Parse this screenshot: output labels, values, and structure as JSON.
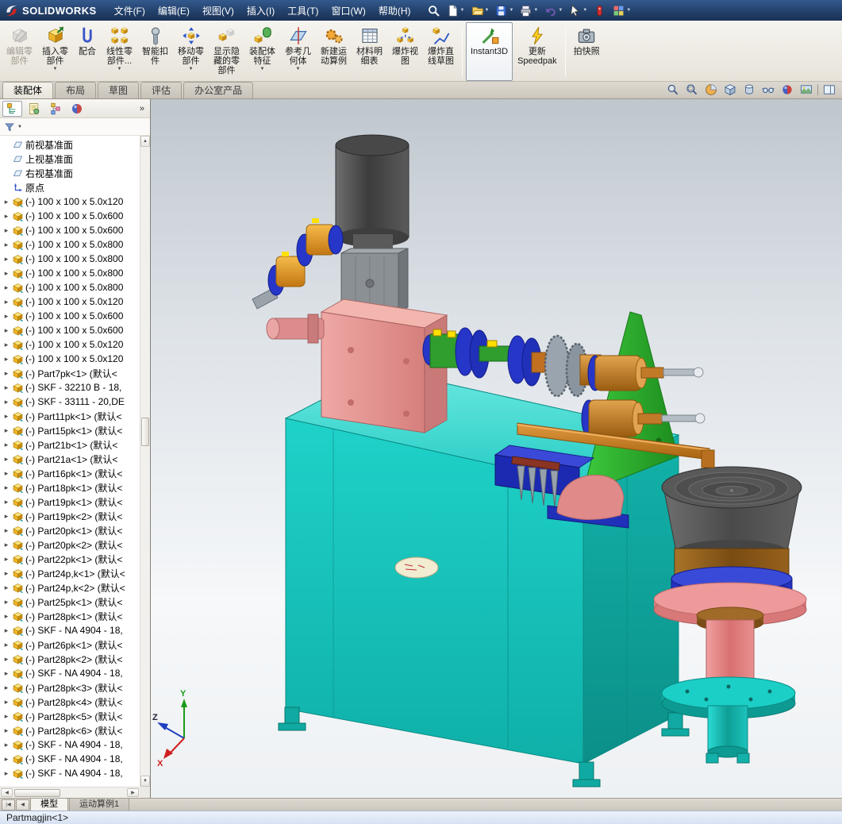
{
  "window": {
    "logo_text": "SOLIDWORKS",
    "status_bar_text": "Partmagjin<1>"
  },
  "menu_bar": {
    "items": [
      "文件(F)",
      "编辑(E)",
      "视图(V)",
      "插入(I)",
      "工具(T)",
      "窗口(W)",
      "帮助(H)"
    ]
  },
  "quick_toolbar": {
    "buttons": [
      {
        "name": "search",
        "dropdown": false
      },
      {
        "name": "new-document",
        "dropdown": true
      },
      {
        "name": "open",
        "dropdown": true
      },
      {
        "name": "save",
        "dropdown": true
      },
      {
        "name": "print",
        "dropdown": true
      },
      {
        "name": "undo",
        "dropdown": true
      },
      {
        "name": "select",
        "dropdown": true
      },
      {
        "name": "rebuild",
        "dropdown": false
      },
      {
        "name": "display-pane",
        "dropdown": true
      }
    ]
  },
  "ribbon": {
    "buttons": [
      {
        "id": "edit-component",
        "label": "编辑零\n部件",
        "dropdown": false,
        "disabled": true
      },
      {
        "id": "insert-component",
        "label": "插入零\n部件",
        "dropdown": true
      },
      {
        "id": "mate",
        "label": "配合",
        "dropdown": false
      },
      {
        "id": "linear-component-pattern",
        "label": "线性零\n部件...",
        "dropdown": true
      },
      {
        "id": "smart-fasteners",
        "label": "智能扣\n件",
        "dropdown": false
      },
      {
        "id": "move-component",
        "label": "移动零\n部件",
        "dropdown": true
      },
      {
        "id": "show-hidden-components",
        "label": "显示隐\n藏的零\n部件",
        "dropdown": false
      },
      {
        "id": "assembly-features",
        "label": "装配体\n特征",
        "dropdown": true
      },
      {
        "id": "reference-geometry",
        "label": "参考几\n何体",
        "dropdown": true
      },
      {
        "id": "new-motion-study",
        "label": "新建运\n动算例",
        "dropdown": false
      },
      {
        "id": "bill-of-materials",
        "label": "材料明\n细表",
        "dropdown": false
      },
      {
        "id": "exploded-view",
        "label": "爆炸视\n图",
        "dropdown": false
      },
      {
        "id": "explode-line-sketch",
        "label": "爆炸直\n线草图",
        "dropdown": false
      },
      {
        "id": "instant3d",
        "label": "Instant3D",
        "dropdown": false,
        "active": true,
        "sep_before": true
      },
      {
        "id": "update-speedpak",
        "label": "更新\nSpeedpak",
        "dropdown": false
      },
      {
        "id": "take-snapshot",
        "label": "拍快照",
        "dropdown": false,
        "sep_before": true
      }
    ]
  },
  "tab_bar": {
    "tabs": [
      {
        "id": "assembly",
        "label": "装配体",
        "active": true
      },
      {
        "id": "layout",
        "label": "布局",
        "active": false
      },
      {
        "id": "sketch",
        "label": "草图",
        "active": false
      },
      {
        "id": "evaluate",
        "label": "评估",
        "active": false
      },
      {
        "id": "office-products",
        "label": "办公室产品",
        "active": false
      }
    ]
  },
  "feature_tree": {
    "panel_tabs": [
      "featuremanager",
      "propertymanager",
      "configurationmanager",
      "displaymanager"
    ],
    "chevrons": "»",
    "items": [
      {
        "icon": "plane",
        "expand": false,
        "label": "前视基准面"
      },
      {
        "icon": "plane",
        "expand": false,
        "label": "上视基准面"
      },
      {
        "icon": "plane",
        "expand": false,
        "label": "右视基准面"
      },
      {
        "icon": "origin",
        "expand": false,
        "label": "原点"
      },
      {
        "icon": "part",
        "expand": true,
        "label": "(-) 100 x 100 x 5.0x120"
      },
      {
        "icon": "part",
        "expand": true,
        "label": "(-) 100 x 100 x 5.0x600"
      },
      {
        "icon": "part",
        "expand": true,
        "label": "(-) 100 x 100 x 5.0x600"
      },
      {
        "icon": "part",
        "expand": true,
        "label": "(-) 100 x 100 x 5.0x800"
      },
      {
        "icon": "part",
        "expand": true,
        "label": "(-) 100 x 100 x 5.0x800"
      },
      {
        "icon": "part",
        "expand": true,
        "label": "(-) 100 x 100 x 5.0x800"
      },
      {
        "icon": "part",
        "expand": true,
        "label": "(-) 100 x 100 x 5.0x800"
      },
      {
        "icon": "part",
        "expand": true,
        "label": "(-) 100 x 100 x 5.0x120"
      },
      {
        "icon": "part",
        "expand": true,
        "label": "(-) 100 x 100 x 5.0x600"
      },
      {
        "icon": "part",
        "expand": true,
        "label": "(-) 100 x 100 x 5.0x600"
      },
      {
        "icon": "part",
        "expand": true,
        "label": "(-) 100 x 100 x 5.0x120"
      },
      {
        "icon": "part",
        "expand": true,
        "label": "(-) 100 x 100 x 5.0x120"
      },
      {
        "icon": "part",
        "expand": true,
        "label": "(-) Part7pk<1> (默认<"
      },
      {
        "icon": "part",
        "expand": true,
        "label": "(-) SKF - 32210 B - 18,"
      },
      {
        "icon": "part",
        "expand": true,
        "label": "(-) SKF - 33111 - 20,DE"
      },
      {
        "icon": "part",
        "expand": true,
        "label": "(-) Part11pk<1> (默认<"
      },
      {
        "icon": "part",
        "expand": true,
        "label": "(-) Part15pk<1> (默认<"
      },
      {
        "icon": "part",
        "expand": true,
        "label": "(-) Part21b<1> (默认<"
      },
      {
        "icon": "part",
        "expand": true,
        "label": "(-) Part21a<1> (默认<"
      },
      {
        "icon": "part",
        "expand": true,
        "label": "(-) Part16pk<1> (默认<"
      },
      {
        "icon": "part",
        "expand": true,
        "label": "(-) Part18pk<1> (默认<"
      },
      {
        "icon": "part",
        "expand": true,
        "label": "(-) Part19pk<1> (默认<"
      },
      {
        "icon": "part",
        "expand": true,
        "label": "(-) Part19pk<2> (默认<"
      },
      {
        "icon": "part",
        "expand": true,
        "label": "(-) Part20pk<1> (默认<"
      },
      {
        "icon": "part",
        "expand": true,
        "label": "(-) Part20pk<2> (默认<"
      },
      {
        "icon": "part",
        "expand": true,
        "label": "(-) Part22pk<1> (默认<"
      },
      {
        "icon": "part",
        "expand": true,
        "label": "(-) Part24p,k<1> (默认<"
      },
      {
        "icon": "part",
        "expand": true,
        "label": "(-) Part24p,k<2> (默认<"
      },
      {
        "icon": "part",
        "expand": true,
        "label": "(-) Part25pk<1> (默认<"
      },
      {
        "icon": "part",
        "expand": true,
        "label": "(-) Part28pk<1> (默认<"
      },
      {
        "icon": "part",
        "expand": true,
        "label": "(-) SKF - NA 4904 - 18,"
      },
      {
        "icon": "part",
        "expand": true,
        "label": "(-) Part26pk<1> (默认<"
      },
      {
        "icon": "part",
        "expand": true,
        "label": "(-) Part28pk<2> (默认<"
      },
      {
        "icon": "part",
        "expand": true,
        "label": "(-) SKF - NA 4904 - 18,"
      },
      {
        "icon": "part",
        "expand": true,
        "label": "(-) Part28pk<3> (默认<"
      },
      {
        "icon": "part",
        "expand": true,
        "label": "(-) Part28pk<4> (默认<"
      },
      {
        "icon": "part",
        "expand": true,
        "label": "(-) Part28pk<5> (默认<"
      },
      {
        "icon": "part",
        "expand": true,
        "label": "(-) Part28pk<6> (默认<"
      },
      {
        "icon": "part",
        "expand": true,
        "label": "(-) SKF - NA 4904 - 18,"
      },
      {
        "icon": "part",
        "expand": true,
        "label": "(-) SKF - NA 4904 - 18,"
      },
      {
        "icon": "part",
        "expand": true,
        "label": "(-) SKF - NA 4904 - 18,"
      }
    ]
  },
  "doc_tabs": {
    "tabs": [
      {
        "label": "模型",
        "active": true
      },
      {
        "label": "运动算例1",
        "active": false
      }
    ]
  },
  "viewport": {
    "triad_labels": {
      "x": "X",
      "y": "Y",
      "z": "Z"
    },
    "headsup_icons": [
      "zoom-fit",
      "zoom-area",
      "section-view",
      "view-orientation",
      "display-style",
      "hide-show",
      "edit-appearance",
      "scene",
      "separator",
      "pane"
    ],
    "model_colors": {
      "cabinet_front": "#17c4bc",
      "cabinet_top": "#56e0d8",
      "cabinet_side": "#0fa29a",
      "gearbox_pink": "#e49090",
      "motor_gray": "#555555",
      "bowl_gray": "#555555",
      "plate_green": "#2eb82e",
      "copper_orange": "#c87a1e",
      "coupling_blue": "#2636c8",
      "key_yellow": "#ffe000",
      "flange_pink": "#ea9090",
      "shaft_green": "#2f9e2f"
    }
  }
}
